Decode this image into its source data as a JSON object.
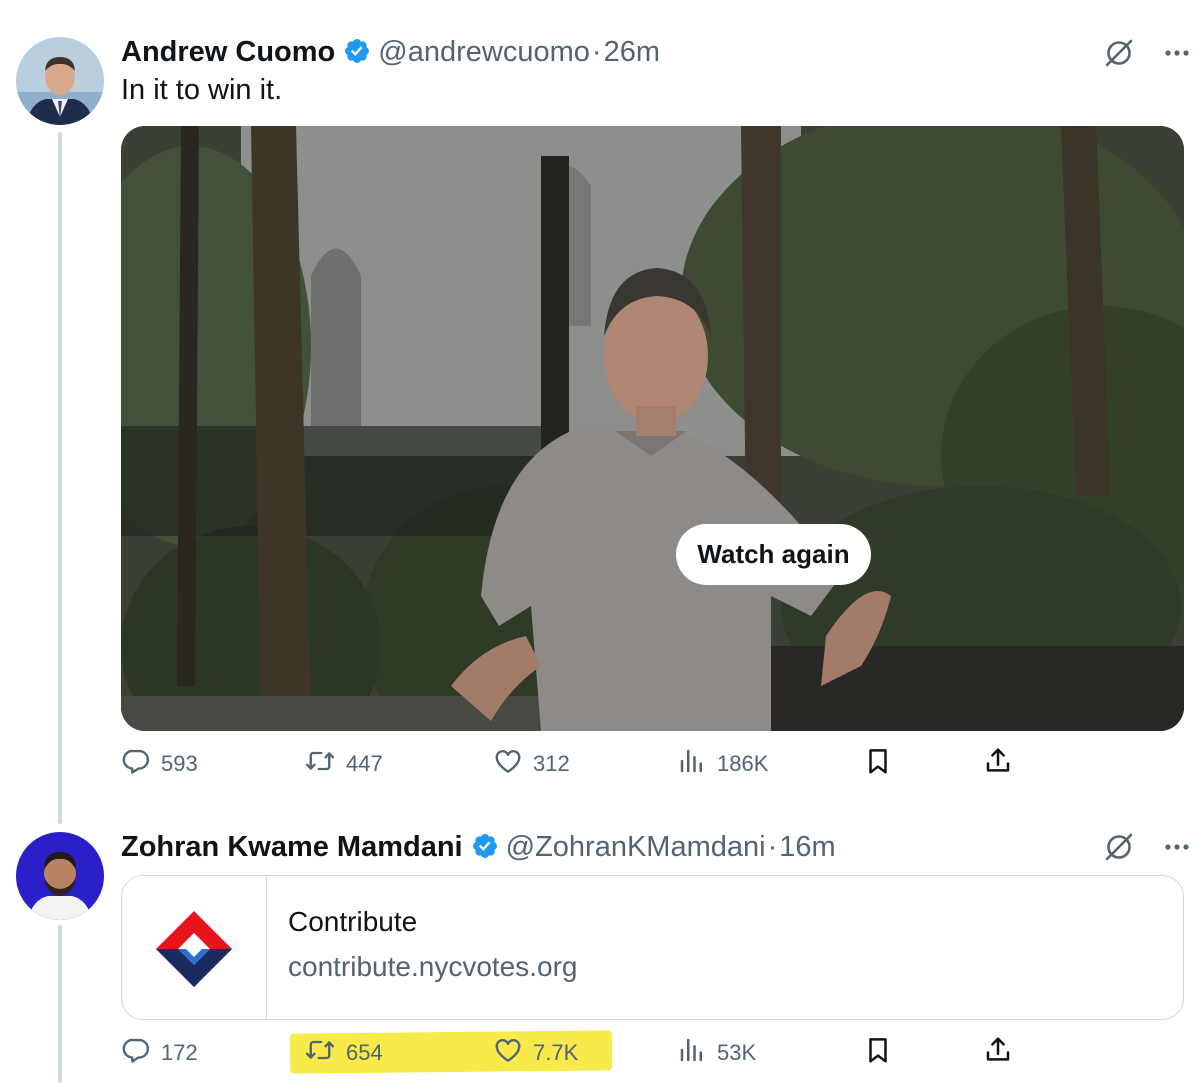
{
  "tweets": [
    {
      "name": "Andrew Cuomo",
      "handle": "@andrewcuomo",
      "separator": "·",
      "time": "26m",
      "text": "In it to win it.",
      "media": {
        "overlay_button": "Watch again"
      },
      "actions": {
        "replies": "593",
        "reposts": "447",
        "likes": "312",
        "views": "186K"
      }
    },
    {
      "name": "Zohran Kwame Mamdani",
      "handle": "@ZohranKMamdani",
      "separator": "·",
      "time": "16m",
      "card": {
        "title": "Contribute",
        "url": "contribute.nycvotes.org"
      },
      "actions": {
        "replies": "172",
        "reposts": "654",
        "likes": "7.7K",
        "views": "53K"
      }
    }
  ],
  "icons": {
    "verified": "verified-badge-icon",
    "grok": "grok-icon",
    "more": "more-icon",
    "reply": "reply-icon",
    "repost": "repost-icon",
    "like": "like-icon",
    "views": "views-icon",
    "bookmark": "bookmark-icon",
    "share": "share-icon"
  },
  "colors": {
    "verified": "#1d9bf0",
    "text_secondary": "#536471",
    "highlight": "#f8ea4a",
    "logo_red": "#e8141c",
    "logo_navy": "#1a2b5e"
  }
}
